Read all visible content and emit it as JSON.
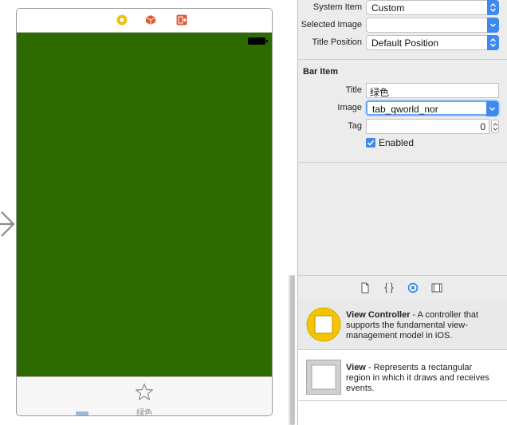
{
  "scene": {
    "tab_item_label": "绿色",
    "view_background_color": "#2d6b00",
    "dock_icons": [
      "view-controller-icon",
      "first-responder-cube-icon",
      "exit-icon"
    ]
  },
  "inspector": {
    "system_item": {
      "label": "System Item",
      "value": "Custom"
    },
    "selected_image": {
      "label": "Selected Image",
      "value": ""
    },
    "title_position": {
      "label": "Title Position",
      "value": "Default Position"
    },
    "bar_item": {
      "heading": "Bar Item",
      "title_label": "Title",
      "title_value": "绿色",
      "image_label": "Image",
      "image_value": "tab_qworld_nor",
      "tag_label": "Tag",
      "tag_value": "0",
      "enabled_label": "Enabled",
      "enabled_checked": true
    }
  },
  "library": {
    "tabs": [
      "file-template-icon",
      "code-snippet-icon",
      "object-library-icon",
      "media-library-icon"
    ],
    "items": [
      {
        "name": "View Controller",
        "description": " - A controller that supports the fundamental view-management model in iOS."
      },
      {
        "name": "View",
        "description": " - Represents a rectangular region in which it draws and receives events."
      }
    ]
  },
  "colors": {
    "accent": "#3d89f0",
    "vc_icon": "#f5c400",
    "cube_icon": "#e05a3a"
  }
}
